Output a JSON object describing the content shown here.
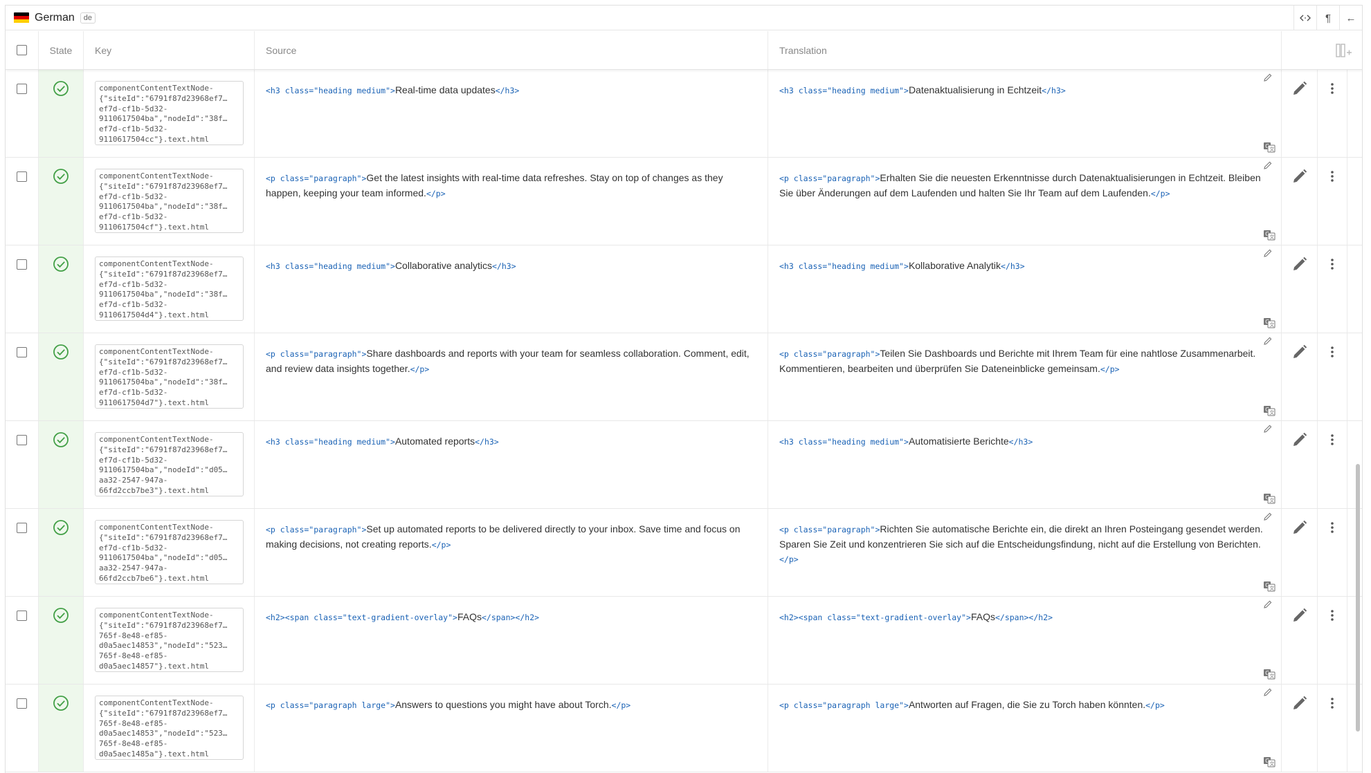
{
  "language": {
    "name": "German",
    "code": "de",
    "flag_colors": [
      "#000000",
      "#dd0000",
      "#ffce00"
    ]
  },
  "toolbar": {
    "code_icon": "<·>",
    "pilcrow_icon": "¶",
    "back_icon": "←"
  },
  "columns": {
    "state": "State",
    "key": "Key",
    "source": "Source",
    "translation": "Translation"
  },
  "colors": {
    "accent_green": "#43a047",
    "tag_blue": "#1a62b5",
    "state_bg": "#eef8ec"
  },
  "rows": [
    {
      "key": "componentContentTextNode-\n{\"siteId\":\"6791f87d23968ef7…\nef7d-cf1b-5d32-\n9110617504ba\",\"nodeId\":\"38f…\nef7d-cf1b-5d32-\n9110617504cc\"}.text.html",
      "src_open": "<h3 class=\"heading medium\">",
      "src_text": "Real-time data updates",
      "src_close": "</h3>",
      "tr_open": "<h3 class=\"heading medium\">",
      "tr_text": "Datenaktualisierung in Echtzeit",
      "tr_close": "</h3>"
    },
    {
      "key": "componentContentTextNode-\n{\"siteId\":\"6791f87d23968ef7…\nef7d-cf1b-5d32-\n9110617504ba\",\"nodeId\":\"38f…\nef7d-cf1b-5d32-\n9110617504cf\"}.text.html",
      "src_open": "<p class=\"paragraph\">",
      "src_text": "Get the latest insights with real-time data refreshes. Stay on top of changes as they happen, keeping your team informed.",
      "src_close": "</p>",
      "tr_open": "<p class=\"paragraph\">",
      "tr_text": "Erhalten Sie die neuesten Erkenntnisse durch Datenaktualisierungen in Echtzeit. Bleiben Sie über Änderungen auf dem Laufenden und halten Sie Ihr Team auf dem Laufenden.",
      "tr_close": "</p>"
    },
    {
      "key": "componentContentTextNode-\n{\"siteId\":\"6791f87d23968ef7…\nef7d-cf1b-5d32-\n9110617504ba\",\"nodeId\":\"38f…\nef7d-cf1b-5d32-\n9110617504d4\"}.text.html",
      "src_open": "<h3 class=\"heading medium\">",
      "src_text": "Collaborative analytics",
      "src_close": "</h3>",
      "tr_open": "<h3 class=\"heading medium\">",
      "tr_text": "Kollaborative Analytik",
      "tr_close": "</h3>"
    },
    {
      "key": "componentContentTextNode-\n{\"siteId\":\"6791f87d23968ef7…\nef7d-cf1b-5d32-\n9110617504ba\",\"nodeId\":\"38f…\nef7d-cf1b-5d32-\n9110617504d7\"}.text.html",
      "src_open": "<p class=\"paragraph\">",
      "src_text": "Share dashboards and reports with your team for seamless collaboration. Comment, edit, and review data insights together.",
      "src_close": "</p>",
      "tr_open": "<p class=\"paragraph\">",
      "tr_text": "Teilen Sie Dashboards und Berichte mit Ihrem Team für eine nahtlose Zusammenarbeit. Kommentieren, bearbeiten und überprüfen Sie Dateneinblicke gemeinsam.",
      "tr_close": "</p>"
    },
    {
      "key": "componentContentTextNode-\n{\"siteId\":\"6791f87d23968ef7…\nef7d-cf1b-5d32-\n9110617504ba\",\"nodeId\":\"d05…\naa32-2547-947a-\n66fd2ccb7be3\"}.text.html",
      "src_open": "<h3 class=\"heading medium\">",
      "src_text": "Automated reports",
      "src_close": "</h3>",
      "tr_open": "<h3 class=\"heading medium\">",
      "tr_text": "Automatisierte Berichte",
      "tr_close": "</h3>"
    },
    {
      "key": "componentContentTextNode-\n{\"siteId\":\"6791f87d23968ef7…\nef7d-cf1b-5d32-\n9110617504ba\",\"nodeId\":\"d05…\naa32-2547-947a-\n66fd2ccb7be6\"}.text.html",
      "src_open": "<p class=\"paragraph\">",
      "src_text": "Set up automated reports to be delivered directly to your inbox. Save time and focus on making decisions, not creating reports.",
      "src_close": "</p>",
      "tr_open": "<p class=\"paragraph\">",
      "tr_text": "Richten Sie automatische Berichte ein, die direkt an Ihren Posteingang gesendet werden. Sparen Sie Zeit und konzentrieren Sie sich auf die Entscheidungsfindung, nicht auf die Erstellung von Berichten.",
      "tr_close": "</p>"
    },
    {
      "key": "componentContentTextNode-\n{\"siteId\":\"6791f87d23968ef7…\n765f-8e48-ef85-\nd0a5aec14853\",\"nodeId\":\"523…\n765f-8e48-ef85-\nd0a5aec14857\"}.text.html",
      "src_open": "<h2><span class=\"text-gradient-overlay\">",
      "src_text": "FAQs",
      "src_close": "</span></h2>",
      "tr_open": "<h2><span class=\"text-gradient-overlay\">",
      "tr_text": "FAQs",
      "tr_close": "</span></h2>"
    },
    {
      "key": "componentContentTextNode-\n{\"siteId\":\"6791f87d23968ef7…\n765f-8e48-ef85-\nd0a5aec14853\",\"nodeId\":\"523…\n765f-8e48-ef85-\nd0a5aec1485a\"}.text.html",
      "src_open": "<p class=\"paragraph large\">",
      "src_text": "Answers to questions you might have about Torch.",
      "src_close": "</p>",
      "tr_open": "<p class=\"paragraph large\">",
      "tr_text": "Antworten auf Fragen, die Sie zu Torch haben könnten.",
      "tr_close": "</p>"
    }
  ]
}
